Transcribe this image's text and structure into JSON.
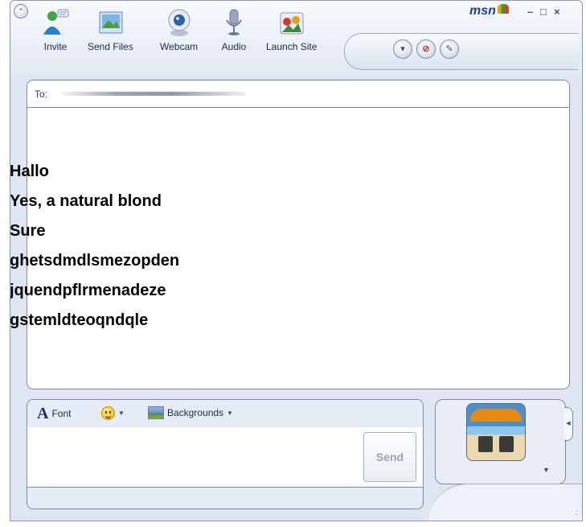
{
  "toolbar": {
    "items": [
      {
        "label": "Invite",
        "icon": "invite-user-icon"
      },
      {
        "label": "Send Files",
        "icon": "send-files-icon"
      },
      {
        "label": "Webcam",
        "icon": "webcam-icon"
      },
      {
        "label": "Audio",
        "icon": "microphone-icon"
      },
      {
        "label": "Launch Site",
        "icon": "launch-site-icon"
      }
    ]
  },
  "brand": {
    "text": "msn"
  },
  "window_controls": {
    "minimize": "–",
    "maximize": "□",
    "close": "×"
  },
  "conversation": {
    "to_label": "To:",
    "messages": [
      "Hallo",
      "Yes, a natural blond",
      "Sure",
      "ghetsdmdlsmezopden",
      "jquendpflrmenadeze",
      "gstemldteoqndqle"
    ],
    "dash": "-"
  },
  "compose": {
    "font_label": "Font",
    "backgrounds_label": "Backgrounds",
    "send_label": "Send"
  },
  "colors": {
    "window_bg": "#dfe6f2",
    "border": "#7d8aa6",
    "brand": "#1b3fa8"
  }
}
